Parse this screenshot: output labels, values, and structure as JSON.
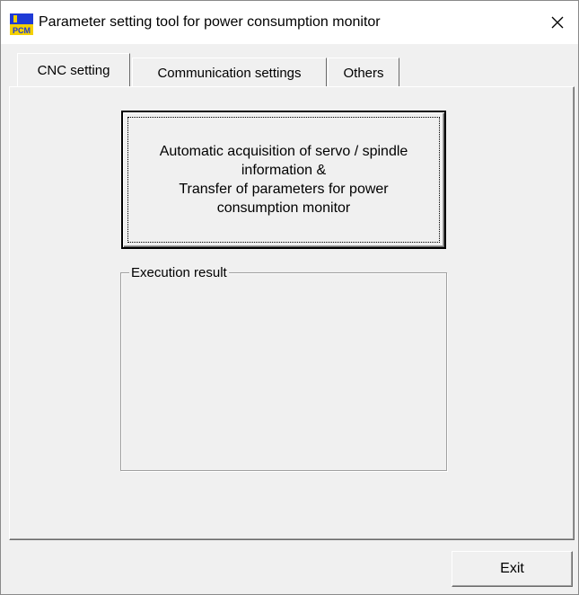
{
  "window": {
    "title": "Parameter setting tool for power consumption monitor",
    "close_symbol": "✕"
  },
  "app_icon": {
    "name": "pcm-app-icon",
    "text": "PCM"
  },
  "tabs": [
    {
      "label": "CNC setting",
      "active": true
    },
    {
      "label": "Communication settings",
      "active": false
    },
    {
      "label": "Others",
      "active": false
    }
  ],
  "main": {
    "acquire_button_label": "Automatic acquisition of servo / spindle\ninformation &\nTransfer of parameters for power\nconsumption monitor",
    "result_group_label": "Execution result"
  },
  "footer": {
    "exit_label": "Exit"
  },
  "colors": {
    "face": "#f0f0f0",
    "highlight": "#ffffff",
    "shadow": "#696969",
    "icon_blue": "#1f3bd6",
    "icon_yellow": "#f4d000"
  }
}
